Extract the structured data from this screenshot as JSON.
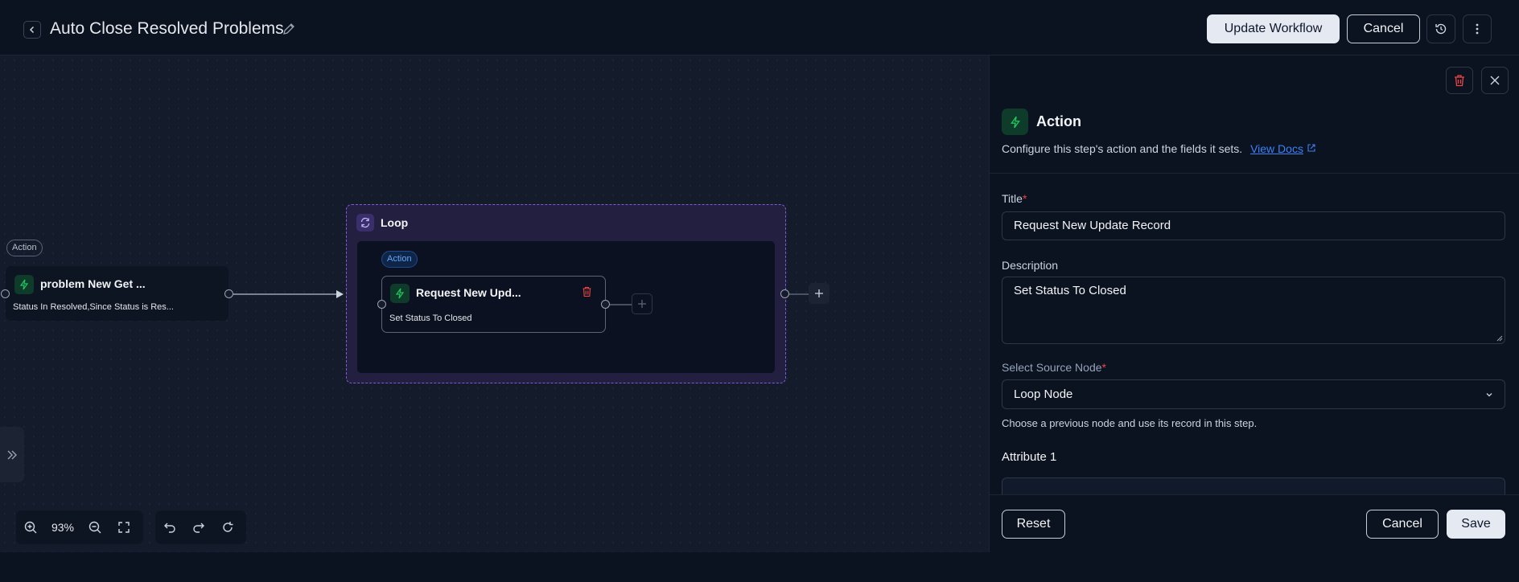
{
  "header": {
    "title": "Auto Close Resolved Problems",
    "update_label": "Update Workflow",
    "cancel_label": "Cancel"
  },
  "canvas": {
    "source_node": {
      "badge": "Action",
      "title": "problem New Get ...",
      "subtitle": "Status In Resolved,Since Status is Res..."
    },
    "loop": {
      "label": "Loop",
      "inner_node": {
        "badge": "Action",
        "title": "Request New Upd...",
        "subtitle": "Set Status To Closed"
      }
    },
    "toolbar": {
      "zoom": "93%"
    }
  },
  "panel": {
    "heading": "Action",
    "description": "Configure this step's action and the fields it sets.",
    "docs_link": "View Docs",
    "title_label": "Title",
    "title_value": "Request New Update Record",
    "description_label": "Description",
    "description_value": "Set Status To Closed",
    "source_label": "Select Source Node",
    "source_value": "Loop Node",
    "source_hint": "Choose a previous node and use its record in this step.",
    "attribute_label": "Attribute 1",
    "reset_label": "Reset",
    "cancel_label": "Cancel",
    "save_label": "Save"
  },
  "colors": {
    "background": "#0a1120",
    "canvas": "#141c2c",
    "loop_border": "#7c5cd6",
    "action_icon_bg": "#0f3b2a",
    "action_icon": "#22c55e",
    "link": "#3b82f6",
    "danger": "#ef4444"
  },
  "icons": [
    "chevron-left-icon",
    "pencil-icon",
    "history-icon",
    "more-vertical-icon",
    "bolt-icon",
    "loop-icon",
    "trash-icon",
    "plus-icon",
    "zoom-in-icon",
    "zoom-out-icon",
    "fullscreen-icon",
    "undo-icon",
    "redo-icon",
    "refresh-icon",
    "double-chevron-right-icon",
    "close-icon",
    "external-link-icon",
    "chevron-down-icon"
  ]
}
